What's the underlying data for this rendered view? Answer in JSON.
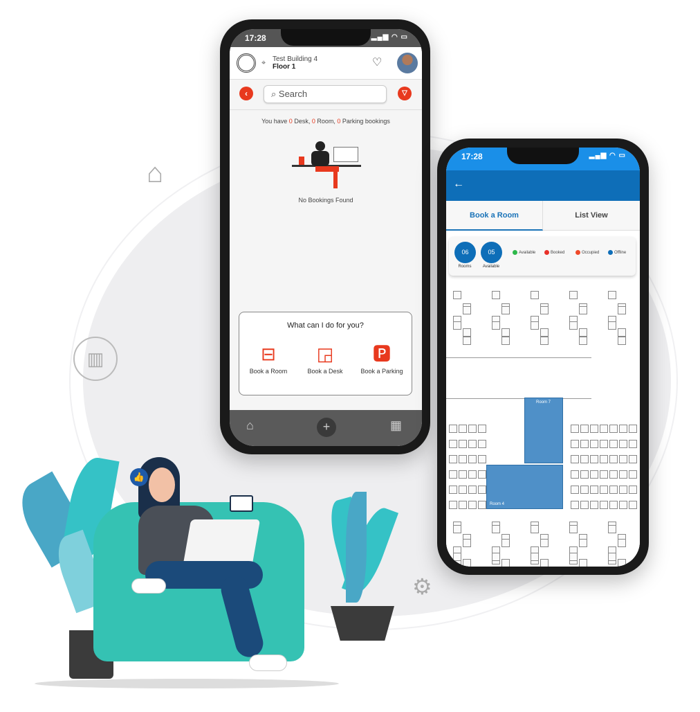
{
  "phone1": {
    "time": "17:28",
    "building": "Test Building 4",
    "floor": "Floor 1",
    "search_placeholder": "Search",
    "bookings": {
      "prefix": "You have ",
      "desk_count": "0",
      "desk": " Desk, ",
      "room_count": "0",
      "room": " Room, ",
      "parking_count": "0",
      "parking": " Parking bookings"
    },
    "empty_state": "No Bookings Found",
    "card": {
      "title": "What can I do for you?",
      "options": [
        {
          "label": "Book a Room",
          "icon": "meeting-table-icon"
        },
        {
          "label": "Book a Desk",
          "icon": "desk-icon"
        },
        {
          "label": "Book a Parking",
          "icon": "parking-car-icon"
        }
      ]
    },
    "accent": "#e8391e"
  },
  "phone2": {
    "time": "17:28",
    "tabs": [
      {
        "label": "Book a Room",
        "active": true
      },
      {
        "label": "List View",
        "active": false
      }
    ],
    "stats": [
      {
        "value": "06",
        "label": "Rooms"
      },
      {
        "value": "05",
        "label": "Available"
      }
    ],
    "legend": [
      {
        "label": "Available",
        "color": "#2db84a"
      },
      {
        "label": "Booked",
        "color": "#e8312a"
      },
      {
        "label": "Occupied",
        "color": "#ef4a2a"
      },
      {
        "label": "Offline",
        "color": "#0e6eb8"
      }
    ],
    "rooms": [
      "Room 7",
      "Room 4"
    ],
    "accent": "#0e6eb8"
  }
}
